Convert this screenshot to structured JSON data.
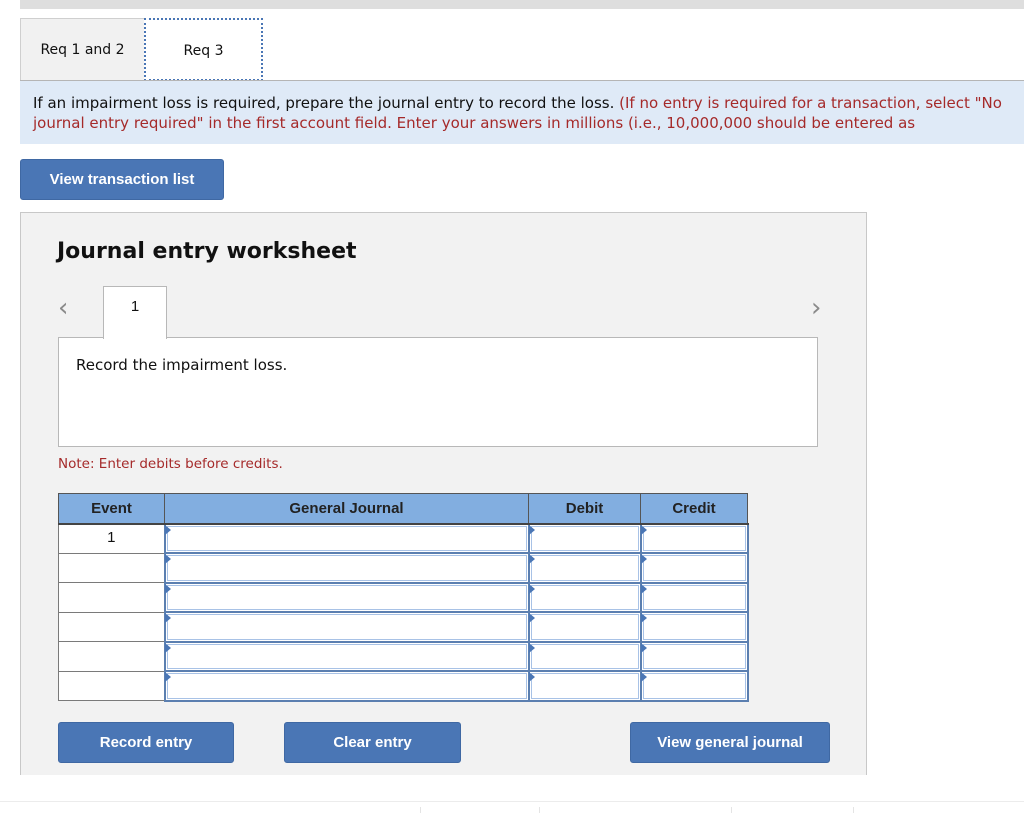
{
  "tabs": [
    {
      "label": "Req 1 and 2",
      "active": false
    },
    {
      "label": "Req 3",
      "active": true
    }
  ],
  "instructions": {
    "main": "If an impairment loss is required, prepare the journal entry to record the loss.",
    "hint": " (If no entry is required for a transaction, select \"No journal entry required\" in the first account field. Enter your answers in millions (i.e., 10,000,000 should be entered as",
    "line2": "journal entry required\" in the first account field. Enter your answers in millions (i.e., 10,000,000 should be entered as"
  },
  "buttons": {
    "view_transaction_list": "View transaction list",
    "record_entry": "Record entry",
    "clear_entry": "Clear entry",
    "view_general_journal": "View general journal"
  },
  "worksheet": {
    "title": "Journal entry worksheet",
    "prev_icon": "‹",
    "next_icon": "›",
    "entry_tab": "1",
    "description": "Record the impairment loss.",
    "note": "Note: Enter debits before credits."
  },
  "journal": {
    "headers": [
      "Event",
      "General Journal",
      "Debit",
      "Credit"
    ],
    "rows": [
      {
        "event": "1",
        "account": "",
        "debit": "",
        "credit": ""
      },
      {
        "event": "",
        "account": "",
        "debit": "",
        "credit": ""
      },
      {
        "event": "",
        "account": "",
        "debit": "",
        "credit": ""
      },
      {
        "event": "",
        "account": "",
        "debit": "",
        "credit": ""
      },
      {
        "event": "",
        "account": "",
        "debit": "",
        "credit": ""
      },
      {
        "event": "",
        "account": "",
        "debit": "",
        "credit": ""
      }
    ]
  },
  "colors": {
    "accent": "#4a76b5",
    "header_blue": "#82aee0",
    "instruction_bg": "#dfeaf7",
    "hint_red": "#a52a2a",
    "panel_bg": "#f2f2f2"
  }
}
